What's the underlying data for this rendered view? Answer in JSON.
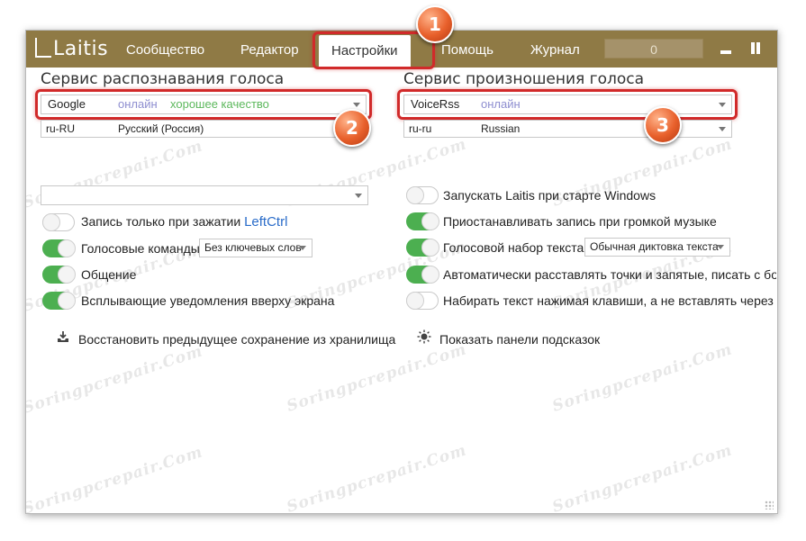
{
  "app": {
    "logo": "Laitis"
  },
  "menu": {
    "community": "Сообщество",
    "editor": "Редактор",
    "settings": "Настройки",
    "help": "Помощь",
    "journal": "Журнал",
    "title_field": "0"
  },
  "recognition": {
    "title": "Сервис распознавания голоса",
    "service": "Google",
    "status": "онлайн",
    "quality": "хорошее качество",
    "lang_code": "ru-RU",
    "lang_name": "Русский (Россия)",
    "empty_select": ""
  },
  "pronunciation": {
    "title": "Сервис произношения голоса",
    "service": "VoiceRss",
    "status": "онлайн",
    "lang_code": "ru-ru",
    "lang_name": "Russian"
  },
  "left_options": {
    "record_hold": {
      "label": "Запись только при зажатии",
      "hotkey": "LeftCtrl",
      "on": false
    },
    "voice_commands": {
      "label": "Голосовые команды",
      "select": "Без ключевых слов",
      "on": true
    },
    "communication": {
      "label": "Общение",
      "on": true
    },
    "popup_notifications": {
      "label": "Всплывающие уведомления вверху экрана",
      "on": true
    },
    "restore_action": "Восстановить предыдущее сохранение из хранилища"
  },
  "right_options": {
    "autostart": {
      "label": "Запускать Laitis при старте Windows",
      "on": false
    },
    "pause_music": {
      "label": "Приостанавливать запись при громкой музыке",
      "on": true
    },
    "voice_typing": {
      "label": "Голосовой набор текста",
      "select": "Обычная диктовка текста",
      "on": true
    },
    "auto_punct": {
      "label": "Автоматически расставлять точки и запятые, писать с бо",
      "on": true
    },
    "type_keys": {
      "label": "Набирать текст нажимая клавиши, а не вставлять через б",
      "on": false
    },
    "hints_action": "Показать панели подсказок"
  },
  "badges": {
    "one": "1",
    "two": "2",
    "three": "3"
  },
  "watermark": "Soringpcrepair.Com",
  "colors": {
    "titlebar": "#8f7a45",
    "toggle_on": "#4caf50",
    "status_online": "#8e8ed0",
    "status_quality": "#5cb85c",
    "hotkey": "#2a6cc9",
    "highlight": "#d12a2a",
    "badge": "#e8602b"
  }
}
